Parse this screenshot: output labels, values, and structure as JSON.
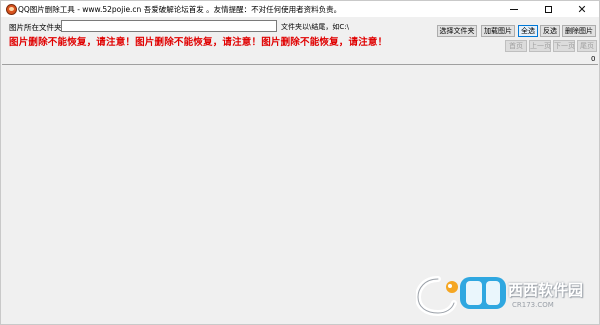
{
  "window": {
    "title": "QQ图片删除工具 - www.52pojie.cn 吾爱破解论坛首发 。友情提醒：不对任何使用者资料负责。",
    "controls": {
      "minimize": "—",
      "maximize": "☐",
      "close": "✕"
    }
  },
  "folder": {
    "label": "图片所在文件夹:",
    "value": "",
    "placeholder": "",
    "hint": "文件夹以\\结尾，如C:\\"
  },
  "warning": "图片删除不能恢复，请注意！图片删除不能恢复，请注意！图片删除不能恢复，请注意！",
  "toolbar": {
    "choose_folder": "选择文件夹",
    "load_images": "加载图片",
    "select_all": "全选",
    "invert": "反选",
    "delete": "删除图片"
  },
  "pager": {
    "first": "首页",
    "prev": "上一页",
    "next": "下一页",
    "last": "尾页"
  },
  "count": "0",
  "watermark": {
    "cn": "西西软件园",
    "site": "CR173.COM"
  },
  "colors": {
    "warning": "#e00000",
    "accent": "#0078d7"
  }
}
